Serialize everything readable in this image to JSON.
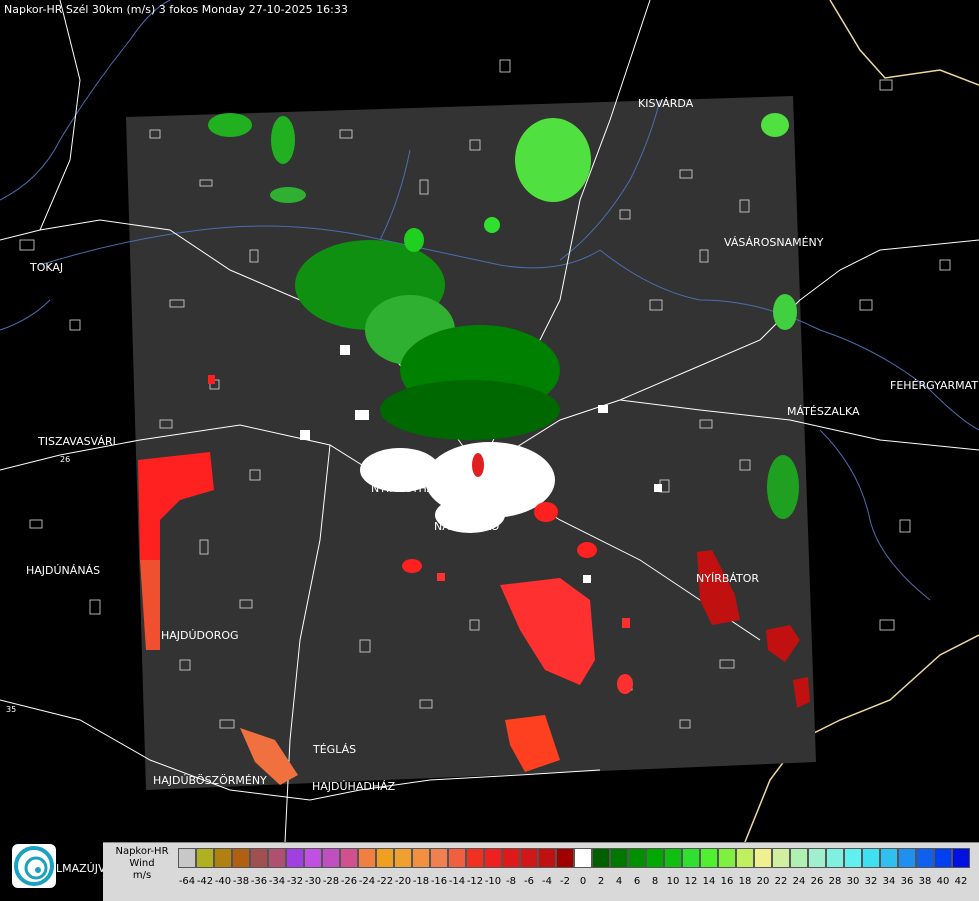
{
  "header": {
    "title": "Napkor-HR Szél 30km (m/s) 3 fokos Monday 27-10-2025 16:33"
  },
  "map": {
    "cities": [
      {
        "name": "KISVÁRDA"
      },
      {
        "name": "VÁSÁROSNAMÉNY"
      },
      {
        "name": "TOKAJ"
      },
      {
        "name": "FEHÉRGYARMAT"
      },
      {
        "name": "MÁTÉSZALKA"
      },
      {
        "name": "TISZAVASVÁRI"
      },
      {
        "name": "NYÍREGYHÁZA"
      },
      {
        "name": "NAGYKÁLLÓ"
      },
      {
        "name": "NYÍRBÁTOR"
      },
      {
        "name": "HAJDÚNÁNÁS"
      },
      {
        "name": "HAJDÚDOROG"
      },
      {
        "name": "TÉGLÁS"
      },
      {
        "name": "HAJDÚBÖSZÖRMÉNY"
      },
      {
        "name": "HAJDÚHADHÁZ"
      },
      {
        "name": "LMAZÚJVÁR"
      }
    ],
    "road_numbers": [
      "26",
      "35"
    ],
    "colors": {
      "background": "#000000",
      "radar_area": "#333333",
      "borders": "#ffffff",
      "rivers": "#4a6fb0",
      "country_border": "#f0d8a0"
    }
  },
  "legend": {
    "title_line1": "Napkor-HR",
    "title_line2": "Wind",
    "unit": "m/s",
    "logo_icon": "radar-logo-icon",
    "logo_text": "LMAZÚJVÁR",
    "scale": [
      {
        "value": "-64",
        "color": "#c8c8c8"
      },
      {
        "value": "-42",
        "color": "#b0b020"
      },
      {
        "value": "-40",
        "color": "#b08010"
      },
      {
        "value": "-38",
        "color": "#b06010"
      },
      {
        "value": "-36",
        "color": "#a05050"
      },
      {
        "value": "-34",
        "color": "#b05070"
      },
      {
        "value": "-32",
        "color": "#a040e0"
      },
      {
        "value": "-30",
        "color": "#c050e0"
      },
      {
        "value": "-28",
        "color": "#c050c0"
      },
      {
        "value": "-26",
        "color": "#d05090"
      },
      {
        "value": "-24",
        "color": "#f08040"
      },
      {
        "value": "-22",
        "color": "#f0a020"
      },
      {
        "value": "-20",
        "color": "#f0a030"
      },
      {
        "value": "-18",
        "color": "#f09040"
      },
      {
        "value": "-16",
        "color": "#f08050"
      },
      {
        "value": "-14",
        "color": "#f06040"
      },
      {
        "value": "-12",
        "color": "#f03020"
      },
      {
        "value": "-10",
        "color": "#f02020"
      },
      {
        "value": "-8",
        "color": "#e01818"
      },
      {
        "value": "-6",
        "color": "#d01818"
      },
      {
        "value": "-4",
        "color": "#c01010"
      },
      {
        "value": "-2",
        "color": "#a00000"
      },
      {
        "value": "0",
        "color": "#ffffff"
      },
      {
        "value": "2",
        "color": "#006000"
      },
      {
        "value": "4",
        "color": "#007800"
      },
      {
        "value": "6",
        "color": "#009000"
      },
      {
        "value": "8",
        "color": "#00a800"
      },
      {
        "value": "10",
        "color": "#10c010"
      },
      {
        "value": "12",
        "color": "#30e030"
      },
      {
        "value": "14",
        "color": "#50f030"
      },
      {
        "value": "16",
        "color": "#80f040"
      },
      {
        "value": "18",
        "color": "#c0f060"
      },
      {
        "value": "20",
        "color": "#f0f090"
      },
      {
        "value": "22",
        "color": "#d0f0a0"
      },
      {
        "value": "24",
        "color": "#b0f0b0"
      },
      {
        "value": "26",
        "color": "#a0f0d0"
      },
      {
        "value": "28",
        "color": "#80f0e0"
      },
      {
        "value": "30",
        "color": "#60f0f0"
      },
      {
        "value": "32",
        "color": "#40e0f0"
      },
      {
        "value": "34",
        "color": "#30c0f0"
      },
      {
        "value": "36",
        "color": "#2090f0"
      },
      {
        "value": "38",
        "color": "#1060f0"
      },
      {
        "value": "40",
        "color": "#0040f0"
      },
      {
        "value": "42",
        "color": "#0010e0"
      }
    ]
  }
}
